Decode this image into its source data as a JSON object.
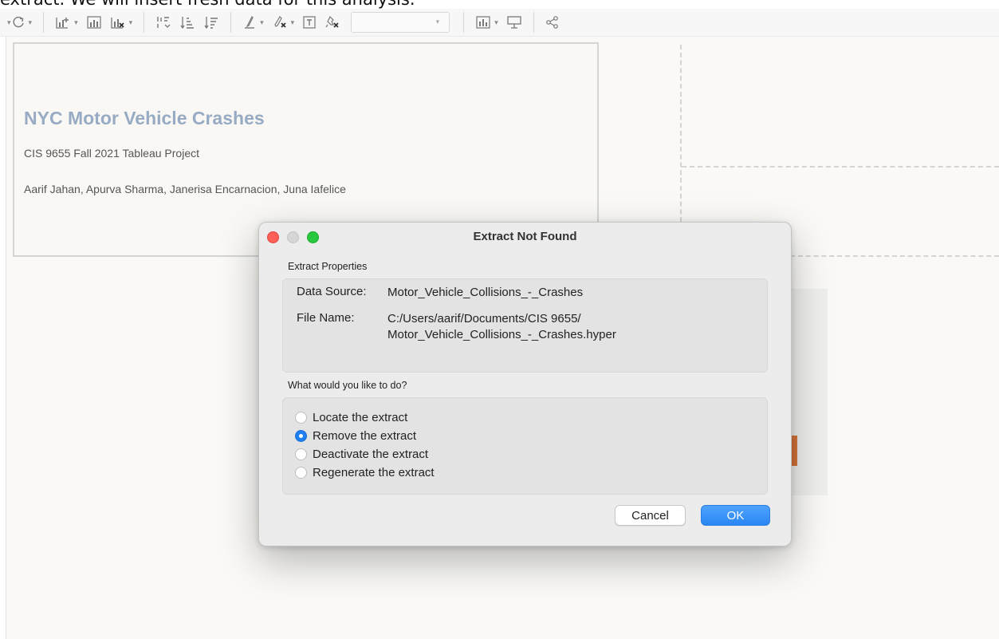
{
  "caption": {
    "text": "extract. We will insert fresh data for this analysis."
  },
  "toolbar": {
    "icons": [
      "refresh-icon",
      "new-worksheet-icon",
      "duplicate-sheet-icon",
      "clear-sheet-icon",
      "swap-axes-icon",
      "sort-ascending-icon",
      "sort-descending-icon",
      "highlight-icon",
      "group-members-icon",
      "show-labels-icon",
      "fix-axes-icon",
      "show-me-icon",
      "presentation-icon",
      "share-icon"
    ]
  },
  "dashboard": {
    "title": "NYC Motor Vehicle Crashes",
    "subtitle": "CIS 9655 Fall 2021 Tableau Project",
    "authors": "Aarif Jahan, Apurva Sharma, Janerisa Encarnacion, Juna Iafelice"
  },
  "dialog": {
    "title": "Extract Not Found",
    "properties_label": "Extract Properties",
    "data_source_label": "Data Source:",
    "data_source_value": "Motor_Vehicle_Collisions_-_Crashes",
    "file_name_label": "File Name:",
    "file_name_line1": "C:/Users/aarif/Documents/CIS 9655/",
    "file_name_line2": "Motor_Vehicle_Collisions_-_Crashes.hyper",
    "question": "What would you like to do?",
    "options": [
      {
        "label": "Locate the extract",
        "checked": false
      },
      {
        "label": "Remove the extract",
        "checked": true
      },
      {
        "label": "Deactivate the extract",
        "checked": false
      },
      {
        "label": "Regenerate the extract",
        "checked": false
      }
    ],
    "cancel_label": "Cancel",
    "ok_label": "OK"
  },
  "colors": {
    "title_blue": "#97abc4",
    "accent_blue": "#1f7ff0",
    "orange_bar": "#d6743a"
  }
}
